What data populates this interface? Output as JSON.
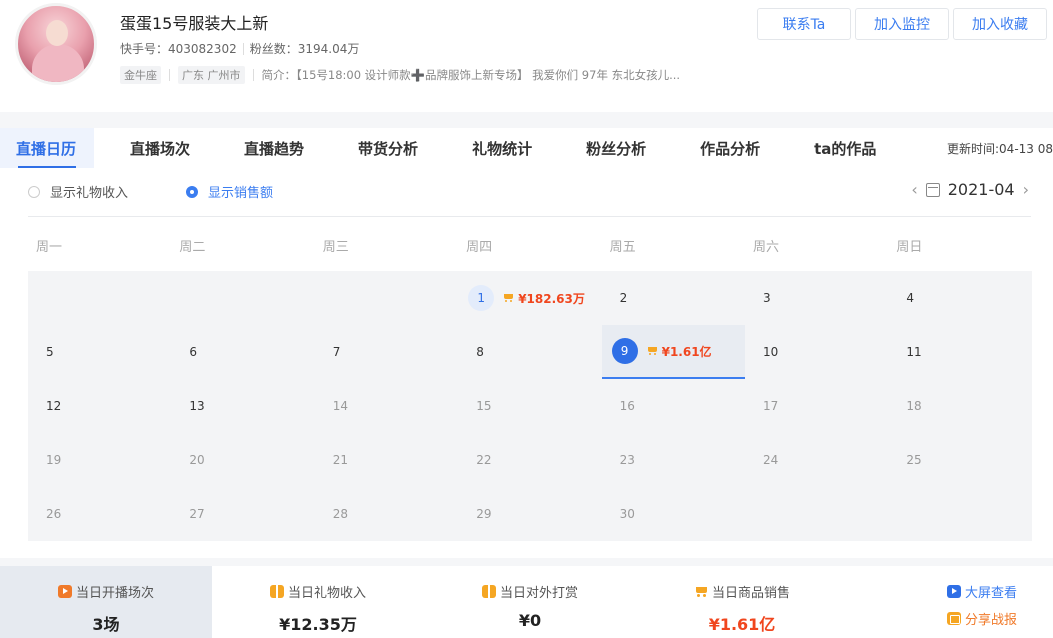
{
  "profile": {
    "name": "蛋蛋15号服装大上新",
    "kuaishou_id": "快手号：403082302",
    "fans": "粉丝数：3194.04万",
    "tag_level": "金牛座",
    "tag_location": "广东 广州市",
    "bio": "简介：【15号18:00 设计师款➕品牌服饰上新专场】 我爱你们 97年 东北女孩儿..."
  },
  "actions": {
    "contact": "联系Ta",
    "monitor": "加入监控",
    "favorite": "加入收藏"
  },
  "tabs": [
    {
      "label": "直播日历",
      "active": true
    },
    {
      "label": "直播场次"
    },
    {
      "label": "直播趋势"
    },
    {
      "label": "带货分析"
    },
    {
      "label": "礼物统计"
    },
    {
      "label": "粉丝分析"
    },
    {
      "label": "作品分析"
    },
    {
      "label": "ta的作品"
    }
  ],
  "update_time": "更新时间:04-13 08",
  "toggles": {
    "gift_income": "显示礼物收入",
    "sales": "显示销售额"
  },
  "month": "2021-04",
  "weekdays": [
    "周一",
    "周二",
    "周三",
    "周四",
    "周五",
    "周六",
    "周日"
  ],
  "calendar": {
    "first_weekday_index": 3,
    "days_in_month": 30,
    "today": 13,
    "selected": 9,
    "sales": {
      "1": "¥182.63万",
      "9": "¥1.61亿"
    }
  },
  "stats": {
    "sessions_label": "当日开播场次",
    "sessions_value": "3场",
    "gift_label": "当日礼物收入",
    "gift_value": "¥12.35万",
    "tip_label": "当日对外打赏",
    "tip_value": "¥0",
    "sales_label": "当日商品销售",
    "sales_value": "¥1.61亿"
  },
  "side_links": {
    "big_screen": "大屏查看",
    "share": "分享战报"
  },
  "colors": {
    "primary": "#2f6fe6",
    "sale_red": "#f0461e",
    "cart_orange": "#f5a623"
  }
}
